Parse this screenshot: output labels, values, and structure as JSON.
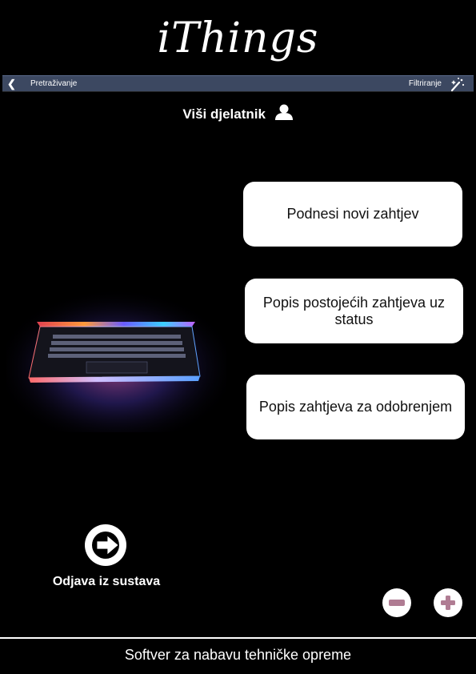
{
  "app": {
    "logo": "iThings"
  },
  "navbar": {
    "back_label": "Pretraživanje",
    "filter_label": "Filtriranje"
  },
  "header": {
    "role": "Viši djelatnik"
  },
  "actions": {
    "new_request": "Podnesi novi zahtjev",
    "list_with_status": "Popis postojećih zahtjeva uz status",
    "list_for_approval": "Popis zahtjeva za odobrenjem"
  },
  "logout": {
    "label": "Odjava iz sustava"
  },
  "footer": {
    "text": "Softver za nabavu tehničke opreme"
  },
  "colors": {
    "background": "#000000",
    "navbar": "#3c4861",
    "zoom_icon": "#b07c93",
    "button": "#ffffff"
  },
  "icons": [
    "chevron-left-icon",
    "magic-wand-icon",
    "user-icon",
    "logout-arrow-icon",
    "zoom-out-icon",
    "zoom-in-icon"
  ]
}
